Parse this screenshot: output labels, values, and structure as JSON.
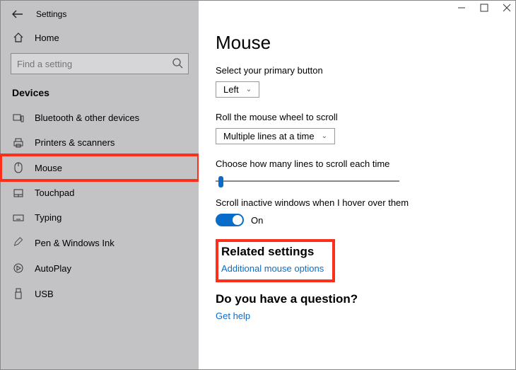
{
  "app_title": "Settings",
  "home_label": "Home",
  "search_placeholder": "Find a setting",
  "section_title": "Devices",
  "nav": [
    {
      "label": "Bluetooth & other devices"
    },
    {
      "label": "Printers & scanners"
    },
    {
      "label": "Mouse"
    },
    {
      "label": "Touchpad"
    },
    {
      "label": "Typing"
    },
    {
      "label": "Pen & Windows Ink"
    },
    {
      "label": "AutoPlay"
    },
    {
      "label": "USB"
    }
  ],
  "page": {
    "title": "Mouse",
    "primary_label": "Select your primary button",
    "primary_value": "Left",
    "scroll_label": "Roll the mouse wheel to scroll",
    "scroll_value": "Multiple lines at a time",
    "lines_label": "Choose how many lines to scroll each time",
    "inactive_label": "Scroll inactive windows when I hover over them",
    "toggle_state": "On",
    "related_heading": "Related settings",
    "related_link": "Additional mouse options",
    "question_heading": "Do you have a question?",
    "question_link": "Get help"
  }
}
